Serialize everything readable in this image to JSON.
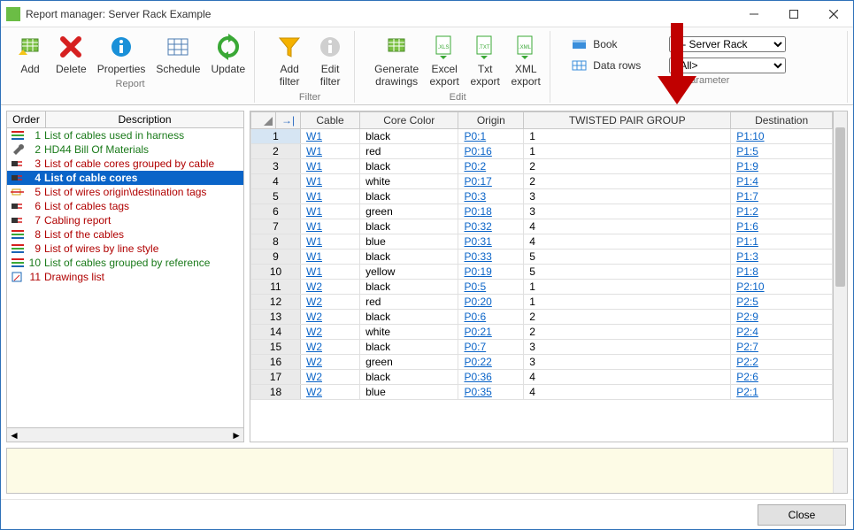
{
  "window": {
    "title": "Report manager: Server Rack Example"
  },
  "ribbon": {
    "groups": {
      "report": {
        "label": "Report",
        "buttons": {
          "add": "Add",
          "delete": "Delete",
          "properties": "Properties",
          "schedule": "Schedule",
          "update": "Update"
        }
      },
      "filter": {
        "label": "Filter",
        "buttons": {
          "add_filter": "Add\nfilter",
          "edit_filter": "Edit\nfilter"
        }
      },
      "edit": {
        "label": "Edit",
        "buttons": {
          "generate": "Generate\ndrawings",
          "excel": "Excel\nexport",
          "txt": "Txt\nexport",
          "xml": "XML\nexport"
        }
      },
      "parameter": {
        "label": "Parameter",
        "book_label": "Book",
        "rows_label": "Data rows",
        "book_value": "1 - Server Rack",
        "rows_value": "<All>",
        "book_options": [
          "1 - Server Rack"
        ],
        "rows_options": [
          "<All>"
        ]
      }
    }
  },
  "left": {
    "headers": {
      "order": "Order",
      "desc": "Description"
    },
    "items": [
      {
        "n": "1",
        "icon": "lines",
        "color": "#1a7a1a",
        "text": "List of cables used in harness"
      },
      {
        "n": "2",
        "icon": "wrench",
        "color": "#1a7a1a",
        "text": "HD44 Bill Of Materials"
      },
      {
        "n": "3",
        "icon": "plug",
        "color": "#b00000",
        "text": "List of cable cores grouped by cable"
      },
      {
        "n": "4",
        "icon": "plug",
        "color": "#000000",
        "text": "List of cable cores",
        "selected": true
      },
      {
        "n": "5",
        "icon": "tag",
        "color": "#b00000",
        "text": "List of wires origin\\destination tags"
      },
      {
        "n": "6",
        "icon": "plug",
        "color": "#b00000",
        "text": "List of cables tags"
      },
      {
        "n": "7",
        "icon": "plug",
        "color": "#b00000",
        "text": "Cabling report"
      },
      {
        "n": "8",
        "icon": "lines",
        "color": "#b00000",
        "text": "List of the cables"
      },
      {
        "n": "9",
        "icon": "lines",
        "color": "#b00000",
        "text": "List of wires by line style"
      },
      {
        "n": "10",
        "icon": "lines",
        "color": "#1a7a1a",
        "text": "List of cables grouped by reference"
      },
      {
        "n": "11",
        "icon": "draw",
        "color": "#b00000",
        "text": "Drawings list"
      }
    ]
  },
  "grid": {
    "columns": [
      "Cable",
      "Core Color",
      "Origin",
      "TWISTED PAIR GROUP",
      "Destination"
    ],
    "rows": [
      {
        "n": 1,
        "cable": "W1",
        "color": "black",
        "origin": "P0:1",
        "group": "1",
        "dest": "P1:10",
        "sel": true
      },
      {
        "n": 2,
        "cable": "W1",
        "color": "red",
        "origin": "P0:16",
        "group": "1",
        "dest": "P1:5"
      },
      {
        "n": 3,
        "cable": "W1",
        "color": "black",
        "origin": "P0:2",
        "group": "2",
        "dest": "P1:9"
      },
      {
        "n": 4,
        "cable": "W1",
        "color": "white",
        "origin": "P0:17",
        "group": "2",
        "dest": "P1:4"
      },
      {
        "n": 5,
        "cable": "W1",
        "color": "black",
        "origin": "P0:3",
        "group": "3",
        "dest": "P1:7"
      },
      {
        "n": 6,
        "cable": "W1",
        "color": "green",
        "origin": "P0:18",
        "group": "3",
        "dest": "P1:2"
      },
      {
        "n": 7,
        "cable": "W1",
        "color": "black",
        "origin": "P0:32",
        "group": "4",
        "dest": "P1:6"
      },
      {
        "n": 8,
        "cable": "W1",
        "color": "blue",
        "origin": "P0:31",
        "group": "4",
        "dest": "P1:1"
      },
      {
        "n": 9,
        "cable": "W1",
        "color": "black",
        "origin": "P0:33",
        "group": "5",
        "dest": "P1:3"
      },
      {
        "n": 10,
        "cable": "W1",
        "color": "yellow",
        "origin": "P0:19",
        "group": "5",
        "dest": "P1:8"
      },
      {
        "n": 11,
        "cable": "W2",
        "color": "black",
        "origin": "P0:5",
        "group": "1",
        "dest": "P2:10"
      },
      {
        "n": 12,
        "cable": "W2",
        "color": "red",
        "origin": "P0:20",
        "group": "1",
        "dest": "P2:5"
      },
      {
        "n": 13,
        "cable": "W2",
        "color": "black",
        "origin": "P0:6",
        "group": "2",
        "dest": "P2:9"
      },
      {
        "n": 14,
        "cable": "W2",
        "color": "white",
        "origin": "P0:21",
        "group": "2",
        "dest": "P2:4"
      },
      {
        "n": 15,
        "cable": "W2",
        "color": "black",
        "origin": "P0:7",
        "group": "3",
        "dest": "P2:7"
      },
      {
        "n": 16,
        "cable": "W2",
        "color": "green",
        "origin": "P0:22",
        "group": "3",
        "dest": "P2:2"
      },
      {
        "n": 17,
        "cable": "W2",
        "color": "black",
        "origin": "P0:36",
        "group": "4",
        "dest": "P2:6"
      },
      {
        "n": 18,
        "cable": "W2",
        "color": "blue",
        "origin": "P0:35",
        "group": "4",
        "dest": "P2:1"
      }
    ]
  },
  "footer": {
    "close": "Close"
  }
}
